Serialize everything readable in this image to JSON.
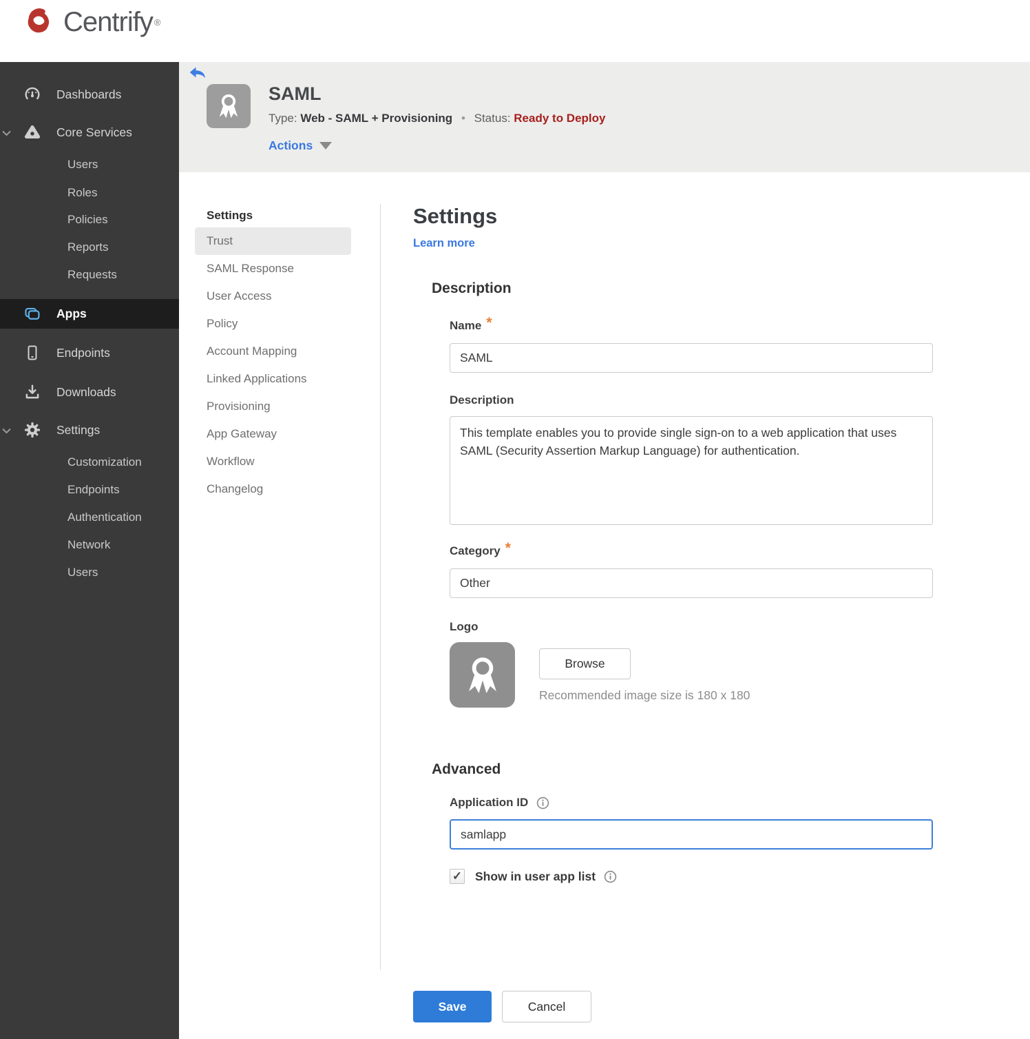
{
  "brand": {
    "name": "Centrify",
    "trademark": "®"
  },
  "sidebar": {
    "dashboards": "Dashboards",
    "core_services": "Core Services",
    "core_services_children": [
      "Users",
      "Roles",
      "Policies",
      "Reports",
      "Requests"
    ],
    "apps": "Apps",
    "endpoints": "Endpoints",
    "downloads": "Downloads",
    "settings": "Settings",
    "settings_children": [
      "Customization",
      "Endpoints",
      "Authentication",
      "Network",
      "Users"
    ]
  },
  "header": {
    "title": "SAML",
    "type_label": "Type:",
    "type_value": "Web - SAML + Provisioning",
    "separator": "•",
    "status_label": "Status:",
    "status_value": "Ready to Deploy",
    "actions_label": "Actions"
  },
  "subnav": {
    "heading": "Settings",
    "selected": "Trust",
    "items": [
      "Trust",
      "SAML Response",
      "User Access",
      "Policy",
      "Account Mapping",
      "Linked Applications",
      "Provisioning",
      "App Gateway",
      "Workflow",
      "Changelog"
    ]
  },
  "main": {
    "title": "Settings",
    "learn_more": "Learn more",
    "description_section": {
      "heading": "Description",
      "name_label": "Name",
      "required_marker": "*",
      "name_value": "SAML",
      "description_label": "Description",
      "description_value": "This template enables you to provide single sign-on to a web application that uses SAML (Security Assertion Markup Language) for authentication.",
      "category_label": "Category",
      "category_value": "Other",
      "logo_label": "Logo",
      "browse_label": "Browse",
      "logo_hint": "Recommended image size is 180 x 180"
    },
    "advanced_section": {
      "heading": "Advanced",
      "app_id_label": "Application ID",
      "app_id_value": "samlapp",
      "checkbox_glyph": "✓",
      "show_in_list_label": "Show in user app list"
    },
    "save_label": "Save",
    "cancel_label": "Cancel"
  },
  "icons": {
    "back": "back-arrow-icon",
    "app_logo": "award-ribbon-icon",
    "info": "info-icon"
  },
  "colors": {
    "accent_blue": "#3a78e0",
    "save_blue": "#2e7cd8",
    "status_red": "#a6211d",
    "required_orange": "#ed7d31",
    "sidebar_bg": "#3a3a3a",
    "apps_icon_blue": "#5eb0ea",
    "brand_red": "#b8352e"
  }
}
